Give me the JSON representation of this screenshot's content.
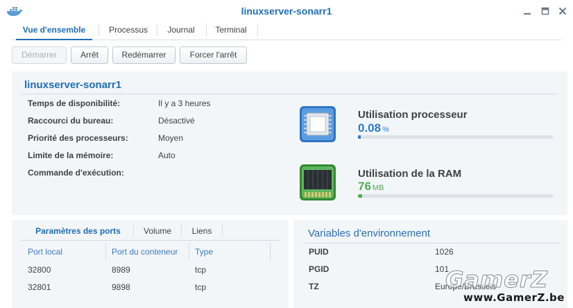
{
  "window": {
    "title": "linuxserver-sonarr1",
    "app_icon": "docker-whale-icon",
    "controls": [
      "minimize-icon",
      "maximize-icon",
      "close-icon"
    ]
  },
  "tabs": [
    {
      "label": "Vue d'ensemble",
      "active": true
    },
    {
      "label": "Processus",
      "active": false
    },
    {
      "label": "Journal",
      "active": false
    },
    {
      "label": "Terminal",
      "active": false
    }
  ],
  "toolbar": {
    "start_label": "Démarrer",
    "stop_label": "Arrêt",
    "restart_label": "Redémarrer",
    "force_stop_label": "Forcer l'arrêt"
  },
  "info": {
    "title": "linuxserver-sonarr1",
    "rows": [
      {
        "label": "Temps de disponibilité:",
        "value": "Il y a 3 heures"
      },
      {
        "label": "Raccourci du bureau:",
        "value": "Désactivé"
      },
      {
        "label": "Priorité des processeurs:",
        "value": "Moyen"
      },
      {
        "label": "Limite de la mémoire:",
        "value": "Auto"
      },
      {
        "label": "Commande d'exécution:",
        "value": ""
      }
    ]
  },
  "resources": {
    "cpu": {
      "title": "Utilisation processeur",
      "value": "0.08",
      "unit": "%",
      "fill_fraction": 0.001,
      "color": "#2b7bc8",
      "icon": "cpu-chip-icon"
    },
    "ram": {
      "title": "Utilisation de la RAM",
      "value": "76",
      "unit": "MB",
      "fill_fraction": 0.02,
      "color": "#4caf50",
      "icon": "ram-module-icon"
    }
  },
  "ports": {
    "tabs": [
      {
        "label": "Paramètres des ports",
        "active": true
      },
      {
        "label": "Volume",
        "active": false
      },
      {
        "label": "Liens",
        "active": false
      }
    ],
    "columns": [
      "Port local",
      "Port du conteneur",
      "Type"
    ],
    "rows": [
      [
        "32800",
        "8989",
        "tcp"
      ],
      [
        "32801",
        "9898",
        "tcp"
      ]
    ]
  },
  "env": {
    "title": "Variables d'environnement",
    "rows": [
      {
        "key": "PUID",
        "value": "1026"
      },
      {
        "key": "PGID",
        "value": "101"
      },
      {
        "key": "TZ",
        "value": "Europe/Brussels"
      }
    ]
  },
  "watermark": {
    "logo": "GamerZ",
    "url": "www.GamerZ.be"
  },
  "colors": {
    "accent": "#1f6db5",
    "panel_bg": "#f3f6f9"
  }
}
